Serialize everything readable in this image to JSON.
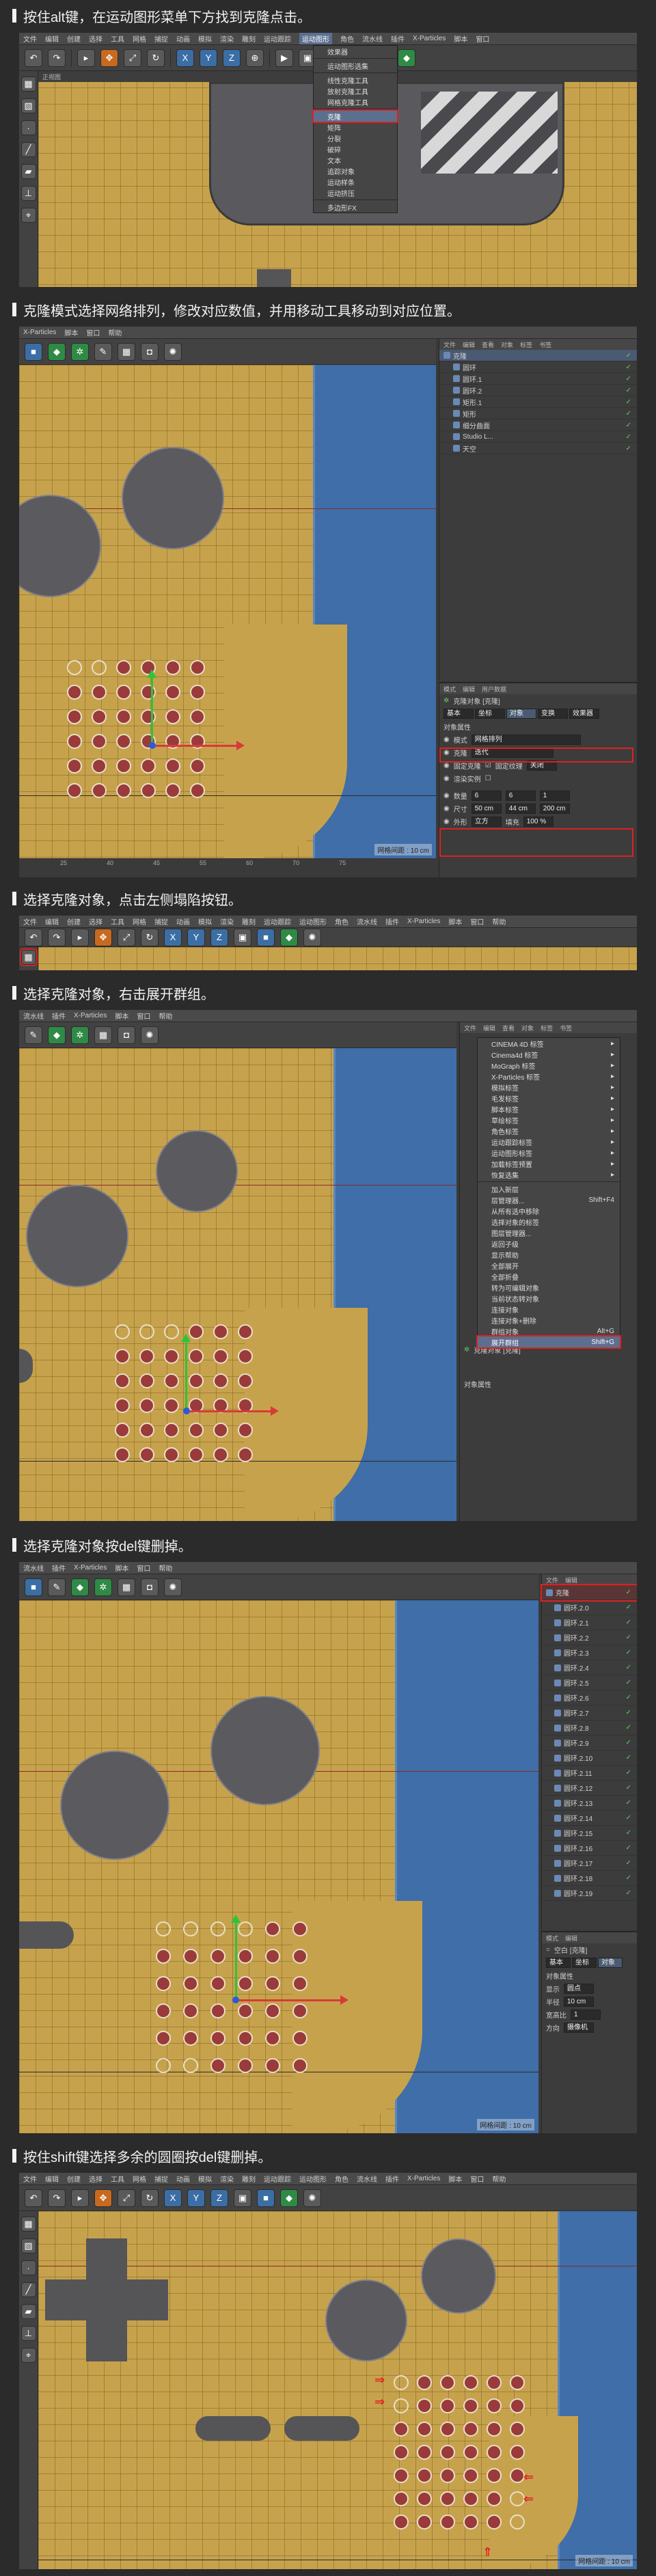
{
  "steps": [
    {
      "title": "按住alt键，在运动图形菜单下方找到克隆点击。"
    },
    {
      "title": "克隆模式选择网络排列，修改对应数值，并用移动工具移动到对应位置。"
    },
    {
      "title": "选择克隆对象，点击左侧塌陷按钮。"
    },
    {
      "title": "选择克隆对象，右击展开群组。"
    },
    {
      "title": "选择克隆对象按del键删掉。"
    },
    {
      "title": "按住shift键选择多余的圆圈按del键删掉。"
    }
  ],
  "shot1": {
    "menus": [
      "文件",
      "编辑",
      "创建",
      "选择",
      "工具",
      "网格",
      "捕捉",
      "动画",
      "模拟",
      "渲染",
      "雕刻",
      "运动跟踪",
      "运动图形",
      "角色",
      "流水线",
      "插件",
      "X-Particles",
      "脚本",
      "窗口",
      "帮助"
    ],
    "active_menu": "运动图形",
    "viewport_label": "正视图",
    "dropdown": [
      "效果器",
      "运动图形选集",
      "线性克隆工具",
      "放射克隆工具",
      "网格克隆工具",
      "克隆",
      "矩阵",
      "分裂",
      "破碎",
      "文本",
      "追踪对象",
      "运动样条",
      "运动挤压",
      "多边形FX"
    ],
    "dropdown_highlight": "克隆"
  },
  "shot2": {
    "menus": [
      "X-Particles",
      "脚本",
      "窗口",
      "帮助"
    ],
    "obj_tabs": [
      "文件",
      "编辑",
      "查看",
      "对象",
      "标签",
      "书签"
    ],
    "objects": [
      {
        "name": "克隆",
        "sel": true
      },
      {
        "name": "圆环",
        "sel": false
      },
      {
        "name": "圆环.1",
        "sel": false
      },
      {
        "name": "圆环.2",
        "sel": false
      },
      {
        "name": "矩形.1",
        "sel": false
      },
      {
        "name": "矩形",
        "sel": false
      },
      {
        "name": "细分曲面",
        "sel": false
      },
      {
        "name": "Studio L...",
        "sel": false
      },
      {
        "name": "天空",
        "sel": false
      }
    ],
    "attr_tabs": [
      "模式",
      "编辑",
      "用户数据"
    ],
    "attr_title": "克隆对象 [克隆]",
    "attr_subtabs": [
      "基本",
      "坐标",
      "对象",
      "变换",
      "效果器"
    ],
    "section": "对象属性",
    "mode_label": "模式",
    "mode_value": "网格排列",
    "clone_label": "克隆",
    "clone_value": "迭代",
    "fixed_clone": "固定克隆",
    "fixed_tex": "固定纹理",
    "fixed_tex_value": "关闭",
    "render_inst": "渲染实例",
    "count_label": "数量",
    "count": [
      "6",
      "6",
      "1"
    ],
    "size_label": "尺寸",
    "size": [
      "50 cm",
      "44 cm",
      "200 cm"
    ],
    "shape_label": "外形",
    "shape_value": "立方",
    "fill_label": "填充",
    "fill_value": "100 %",
    "ruler": [
      "25",
      "40",
      "45",
      "55",
      "60",
      "70",
      "75"
    ],
    "grid_dist": "网格间距 : 10 cm"
  },
  "shot3": {
    "menus": [
      "文件",
      "编辑",
      "创建",
      "选择",
      "工具",
      "网格",
      "捕捉",
      "动画",
      "模拟",
      "渲染",
      "雕刻",
      "运动跟踪",
      "运动图形",
      "角色",
      "流水线",
      "插件",
      "X-Particles",
      "脚本",
      "窗口",
      "帮助"
    ]
  },
  "shot4": {
    "menus": [
      "流水线",
      "插件",
      "X-Particles",
      "脚本",
      "窗口",
      "帮助"
    ],
    "obj_tabs": [
      "文件",
      "编辑",
      "查看",
      "对象",
      "标签",
      "书签"
    ],
    "ctx_items": [
      "CINEMA 4D 标签",
      "Cinema4d 标签",
      "MoGraph 标签",
      "X-Particles 标签",
      "模拟标签",
      "毛发标签",
      "脚本标签",
      "草绘标签",
      "角色标签",
      "运动跟踪标签",
      "运动图形标签",
      "加载标签预置",
      "恢复选集"
    ],
    "ctx_items2": [
      "加入新层",
      "层管理器...",
      "从所有选中移除",
      "选择对象的标签",
      "图层管理器...",
      "返回子级",
      "显示帮助",
      "全部展开",
      "全部折叠",
      "转为可编辑对象",
      "当前状态转对象",
      "连接对象",
      "连接对象+删除",
      "群组对象",
      "展开群组"
    ],
    "shortcuts": {
      "layer_manager": "Shift+F4",
      "group": "Alt+G",
      "expand": "Shift+G"
    },
    "highlight": "展开群组",
    "attr_tabs": [
      "模式",
      "编辑",
      "用户数据"
    ],
    "attr_title": "克隆对象 [克隆]",
    "attr_subtab": "基本",
    "section": "对象属性"
  },
  "shot5": {
    "menus": [
      "流水线",
      "插件",
      "X-Particles",
      "脚本",
      "窗口",
      "帮助"
    ],
    "obj_tabs": [
      "文件",
      "编辑"
    ],
    "objects": [
      "克隆",
      "圆环.2.0",
      "圆环.2.1",
      "圆环.2.2",
      "圆环.2.3",
      "圆环.2.4",
      "圆环.2.5",
      "圆环.2.6",
      "圆环.2.7",
      "圆环.2.8",
      "圆环.2.9",
      "圆环.2.10",
      "圆环.2.11",
      "圆环.2.12",
      "圆环.2.13",
      "圆环.2.14",
      "圆环.2.15",
      "圆环.2.16",
      "圆环.2.17",
      "圆环.2.18",
      "圆环.2.19"
    ],
    "attr_tabs": [
      "模式",
      "编辑"
    ],
    "attr_title": "空白 [克隆]",
    "attr_subtabs": [
      "基本",
      "坐标",
      "对象"
    ],
    "section": "对象属性",
    "display_label": "显示",
    "display_value": "圆点",
    "radius_label": "半径",
    "radius_value": "10 cm",
    "aspect_label": "宽高比",
    "aspect_value": "1",
    "orient_label": "方向",
    "orient_value": "摄像机",
    "grid_dist": "网格间距 : 10 cm"
  },
  "shot6": {
    "menus": [
      "文件",
      "编辑",
      "创建",
      "选择",
      "工具",
      "网格",
      "捕捉",
      "动画",
      "模拟",
      "渲染",
      "雕刻",
      "运动跟踪",
      "运动图形",
      "角色",
      "流水线",
      "插件",
      "X-Particles",
      "脚本",
      "窗口",
      "帮助"
    ],
    "grid_dist": "网格间距 : 10 cm"
  }
}
